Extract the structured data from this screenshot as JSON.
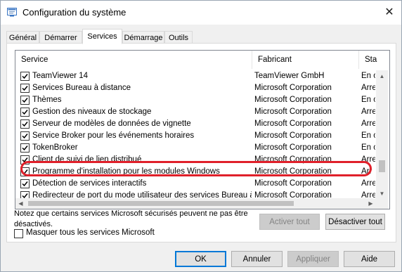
{
  "window": {
    "title": "Configuration du système",
    "icon": "msconfig-icon"
  },
  "tabs": [
    {
      "label": "Général",
      "active": false
    },
    {
      "label": "Démarrer",
      "active": false
    },
    {
      "label": "Services",
      "active": true
    },
    {
      "label": "Démarrage",
      "active": false
    },
    {
      "label": "Outils",
      "active": false
    }
  ],
  "table": {
    "headers": {
      "service": "Service",
      "fabricant": "Fabricant",
      "statut": "Sta"
    },
    "rows": [
      {
        "name": "TeamViewer 14",
        "fabricant": "TeamViewer GmbH",
        "statut": "En c",
        "checked": true
      },
      {
        "name": "Services Bureau à distance",
        "fabricant": "Microsoft Corporation",
        "statut": "Arre",
        "checked": true
      },
      {
        "name": "Thèmes",
        "fabricant": "Microsoft Corporation",
        "statut": "En c",
        "checked": true
      },
      {
        "name": "Gestion des niveaux de stockage",
        "fabricant": "Microsoft Corporation",
        "statut": "Arre",
        "checked": true
      },
      {
        "name": "Serveur de modèles de données de vignette",
        "fabricant": "Microsoft Corporation",
        "statut": "Arre",
        "checked": true
      },
      {
        "name": "Service Broker pour les événements horaires",
        "fabricant": "Microsoft Corporation",
        "statut": "En c",
        "checked": true
      },
      {
        "name": "TokenBroker",
        "fabricant": "Microsoft Corporation",
        "statut": "En c",
        "checked": true
      },
      {
        "name": "Client de suivi de lien distribué",
        "fabricant": "Microsoft Corporation",
        "statut": "Arre",
        "checked": true
      },
      {
        "name": "Programme d'installation pour les modules Windows",
        "fabricant": "Microsoft Corporation",
        "statut": "Arr",
        "checked": true
      },
      {
        "name": "Détection de services interactifs",
        "fabricant": "Microsoft Corporation",
        "statut": "Arre",
        "checked": true
      },
      {
        "name": "Redirecteur de port du mode utilisateur des services Bureau à...",
        "fabricant": "Microsoft Corporation",
        "statut": "Arre",
        "checked": true
      }
    ]
  },
  "notice": "Notez que certains services Microsoft sécurisés peuvent ne pas être désactivés.",
  "buttons": {
    "enable_all": "Activer tout",
    "disable_all": "Désactiver tout",
    "ok": "OK",
    "cancel": "Annuler",
    "apply": "Appliquer",
    "help": "Aide"
  },
  "hide_ms": {
    "label": "Masquer tous les services Microsoft",
    "checked": false
  },
  "colors": {
    "highlight": "#e0202a",
    "accent": "#0078d7"
  }
}
